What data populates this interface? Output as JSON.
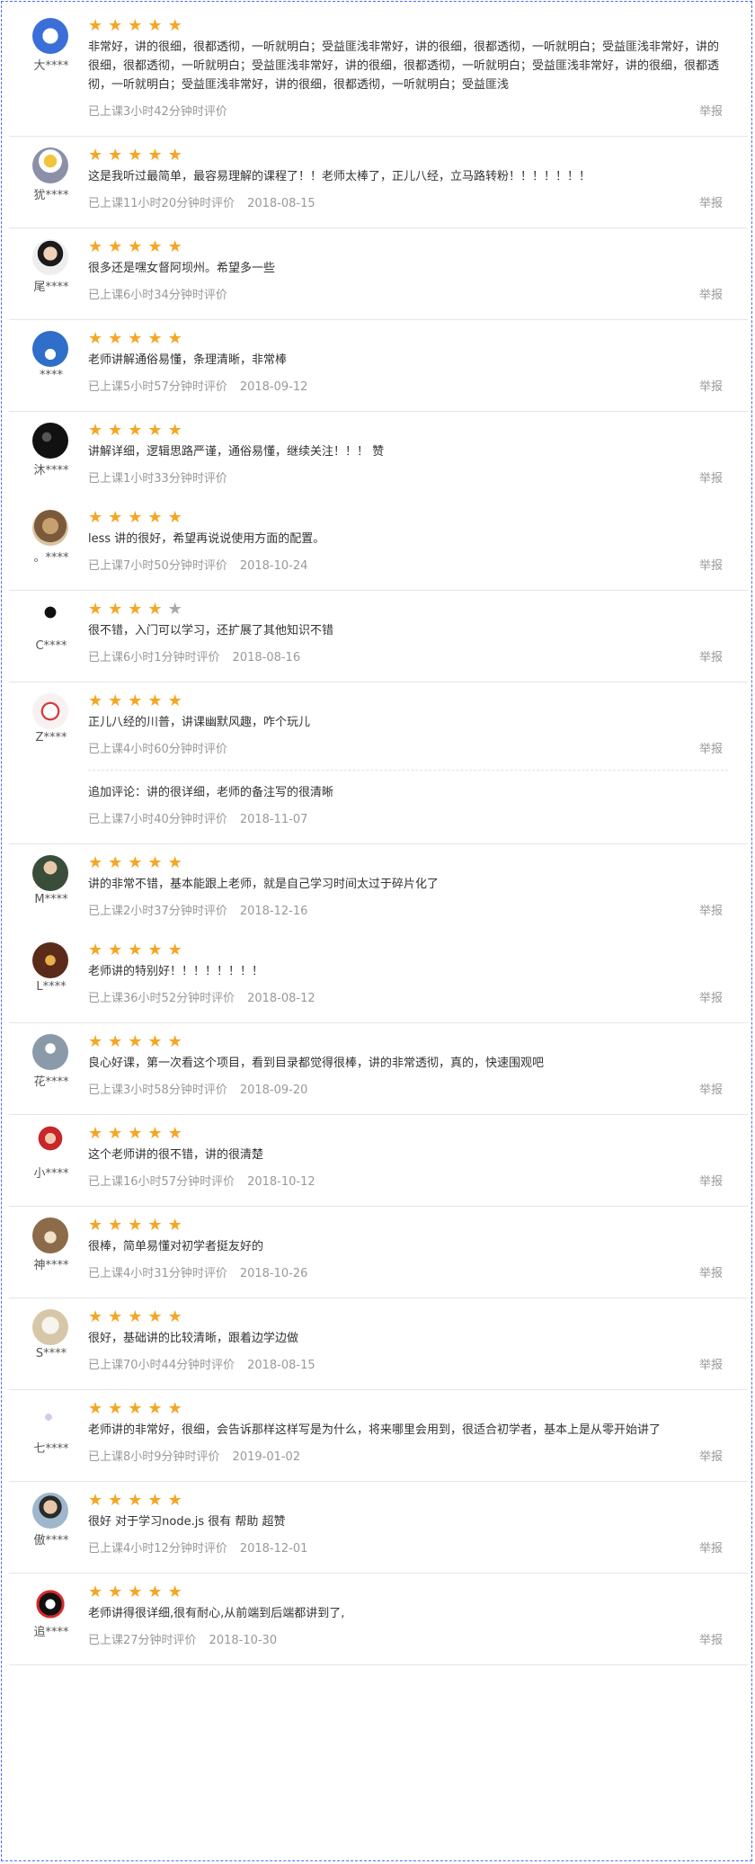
{
  "report_label": "举报",
  "reviews": [
    {
      "entries": [
        {
          "user": "大****",
          "avatar": "qr",
          "stars": 5,
          "text": "非常好，讲的很细，很都透彻，一听就明白；受益匪浅非常好，讲的很细，很都透彻，一听就明白；受益匪浅非常好，讲的很细，很都透彻，一听就明白；受益匪浅非常好，讲的很细，很都透彻，一听就明白；受益匪浅非常好，讲的很细，很都透彻，一听就明白；受益匪浅非常好，讲的很细，很都透彻，一听就明白；受益匪浅",
          "time": "已上课3小时42分钟时评价",
          "date": ""
        }
      ]
    },
    {
      "entries": [
        {
          "user": "犹****",
          "avatar": "robot",
          "stars": 5,
          "text": "这是我听过最简单，最容易理解的课程了！！老师太棒了，正儿八经，立马路转粉！！！！！！！",
          "time": "已上课11小时20分钟时评价",
          "date": "2018-08-15"
        }
      ]
    },
    {
      "entries": [
        {
          "user": "尾****",
          "avatar": "man",
          "stars": 5,
          "text": "很多还是嘿女督阿坝州。希望多一些",
          "time": "已上课6小时34分钟时评价",
          "date": ""
        }
      ]
    },
    {
      "entries": [
        {
          "user": "****",
          "avatar": "blue",
          "stars": 5,
          "text": "老师讲解通俗易懂，条理清晰，非常棒",
          "time": "已上课5小时57分钟时评价",
          "date": "2018-09-12"
        }
      ]
    },
    {
      "entries": [
        {
          "user": "沐****",
          "avatar": "dark",
          "stars": 5,
          "text": "讲解详细，逻辑思路严谨，通俗易懂，继续关注！！！ 赞",
          "time": "已上课1小时33分钟时评价",
          "date": ""
        },
        {
          "user": "。****",
          "avatar": "cat",
          "stars": 5,
          "text": "less 讲的很好，希望再说说使用方面的配置。",
          "time": "已上课7小时50分钟时评价",
          "date": "2018-10-24"
        }
      ]
    },
    {
      "entries": [
        {
          "user": "C****",
          "avatar": "silhouette",
          "stars": 4,
          "text": "很不错，入门可以学习，还扩展了其他知识不错",
          "time": "已上课6小时1分钟时评价",
          "date": "2018-08-16"
        }
      ]
    },
    {
      "entries": [
        {
          "user": "Z****",
          "avatar": "seal",
          "stars": 5,
          "text": "正儿八经的川普，讲课幽默风趣，咋个玩儿",
          "time": "已上课4小时60分钟时评价",
          "date": "",
          "append": {
            "text": "追加评论：讲的很详细，老师的备注写的很清晰",
            "time": "已上课7小时40分钟时评价",
            "date": "2018-11-07"
          }
        }
      ]
    },
    {
      "entries": [
        {
          "user": "M****",
          "avatar": "suit",
          "stars": 5,
          "text": "讲的非常不错，基本能跟上老师，就是自己学习时间太过于碎片化了",
          "time": "已上课2小时37分钟时评价",
          "date": "2018-12-16"
        },
        {
          "user": "L****",
          "avatar": "brown",
          "stars": 5,
          "text": "老师讲的特别好！！！！！！！！",
          "time": "已上课36小时52分钟时评价",
          "date": "2018-08-12"
        }
      ]
    },
    {
      "entries": [
        {
          "user": "花****",
          "avatar": "gray",
          "stars": 5,
          "text": "良心好课，第一次看这个项目，看到目录都觉得很棒，讲的非常透彻，真的，快速围观吧",
          "time": "已上课3小时58分钟时评价",
          "date": "2018-09-20"
        }
      ]
    },
    {
      "entries": [
        {
          "user": "小****",
          "avatar": "girl",
          "stars": 5,
          "text": "这个老师讲的很不错，讲的很清楚",
          "time": "已上课16小时57分钟时评价",
          "date": "2018-10-12"
        }
      ]
    },
    {
      "entries": [
        {
          "user": "神****",
          "avatar": "hedgehog",
          "stars": 5,
          "text": "很棒，简单易懂对初学者挺友好的",
          "time": "已上课4小时31分钟时评价",
          "date": "2018-10-26"
        }
      ]
    },
    {
      "entries": [
        {
          "user": "S****",
          "avatar": "dog",
          "stars": 5,
          "text": "很好，基础讲的比较清晰，跟着边学边做",
          "time": "已上课70小时44分钟时评价",
          "date": "2018-08-15"
        }
      ]
    },
    {
      "entries": [
        {
          "user": "七****",
          "avatar": "light",
          "stars": 5,
          "text": "老师讲的非常好，很细，会告诉那样这样写是为什么，将来哪里会用到，很适合初学者，基本上是从零开始讲了",
          "time": "已上课8小时9分钟时评价",
          "date": "2019-01-02"
        }
      ]
    },
    {
      "entries": [
        {
          "user": "傲****",
          "avatar": "face",
          "stars": 5,
          "text": "很好 对于学习node.js 很有 帮助 超赞",
          "time": "已上课4小时12分钟时评价",
          "date": "2018-12-01"
        }
      ]
    },
    {
      "entries": [
        {
          "user": "追****",
          "avatar": "penguin",
          "stars": 5,
          "text": "老师讲得很详细,很有耐心,从前端到后端都讲到了,",
          "time": "已上课27分钟时评价",
          "date": "2018-10-30"
        }
      ]
    }
  ]
}
